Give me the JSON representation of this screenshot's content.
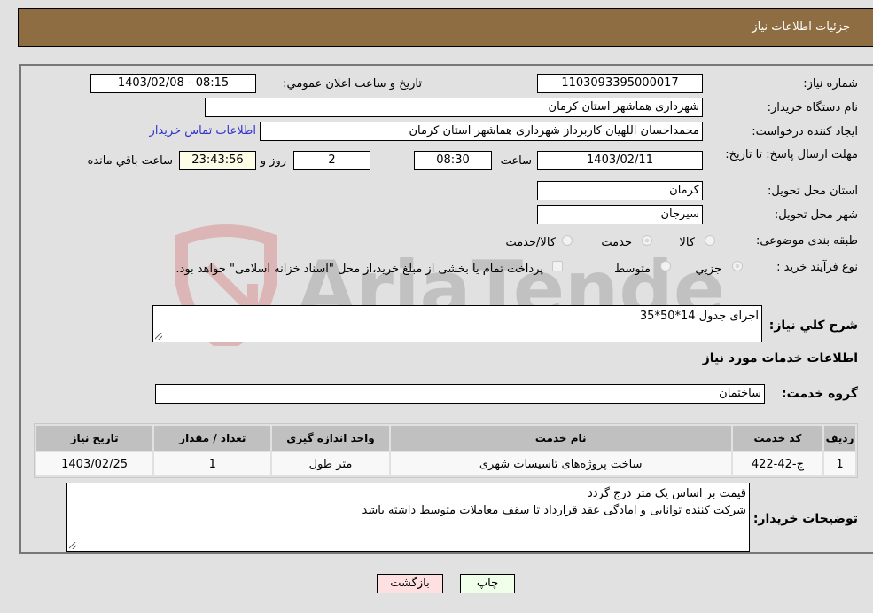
{
  "header": {
    "title": "جزئیات اطلاعات نیاز"
  },
  "form": {
    "need_number": {
      "label": "شماره نیاز:",
      "value": "1103093395000017"
    },
    "announce_datetime": {
      "label": "تاریخ و ساعت اعلان عمومي:",
      "value": "1403/02/08 - 08:15"
    },
    "buyer_org": {
      "label": "نام دستگاه خريدار:",
      "value": "شهرداری هماشهر استان کرمان"
    },
    "requester": {
      "label": "ايجاد کننده درخواست:",
      "value": "محمداحسان اللهیان کاربرداز  شهرداری هماشهر استان کرمان"
    },
    "buyer_contact_link": "اطلاعات تماس خريدار",
    "deadline": {
      "label": "مهلت ارسال پاسخ: تا تاريخ:",
      "date": "1403/02/11",
      "time_label": "ساعت",
      "time": "08:30",
      "days": "2",
      "days_label": "روز و",
      "remaining": "23:43:56",
      "remaining_label": "ساعت باقي مانده"
    },
    "delivery_province": {
      "label": "استان محل تحويل:",
      "value": "کرمان"
    },
    "delivery_city": {
      "label": "شهر محل تحويل:",
      "value": "سیرجان"
    },
    "category": {
      "label": "طبقه بندی موضوعی:",
      "options": [
        "کالا",
        "خدمت",
        "کالا/خدمت"
      ],
      "selected": "خدمت"
    },
    "purchase_type": {
      "label": "نوع فرآيند خريد :",
      "options": [
        "جزيي",
        "متوسط"
      ],
      "selected": "جزيي",
      "treasury_note": "پرداخت تمام يا بخشی از مبلغ خريد،از محل \"اسناد خزانه اسلامی\" خواهد بود."
    },
    "description": {
      "label": "شرح کلي نياز:",
      "value": "اجرای جدول 14*50*35"
    },
    "services_section_title": "اطلاعات خدمات مورد نياز",
    "service_group": {
      "label": "گروه خدمت:",
      "value": "ساختمان"
    }
  },
  "table": {
    "headers": [
      "رديف",
      "کد خدمت",
      "نام خدمت",
      "واحد اندازه گيری",
      "تعداد / مقدار",
      "تاريخ نياز"
    ],
    "rows": [
      [
        "1",
        "ج-42-422",
        "ساخت پروژه‌های تاسیسات شهری",
        "متر طول",
        "1",
        "1403/02/25"
      ]
    ]
  },
  "buyer_notes": {
    "label": "توضيحات خريدار:",
    "lines": [
      "قیمت بر اساس یک متر درج گردد",
      "شرکت کننده توانایی و امادگی عقد قرارداد تا سقف معاملات متوسط داشته باشد"
    ]
  },
  "buttons": {
    "print": "چاپ",
    "back": "بازگشت"
  },
  "watermark": {
    "text": "AriaTender.neT"
  },
  "colors": {
    "header_bg": "#8e6d42",
    "link": "#3333cc",
    "print_bg": "#efffe9",
    "back_bg": "#ffe0e0",
    "remaining_bg": "#fdfde7"
  }
}
